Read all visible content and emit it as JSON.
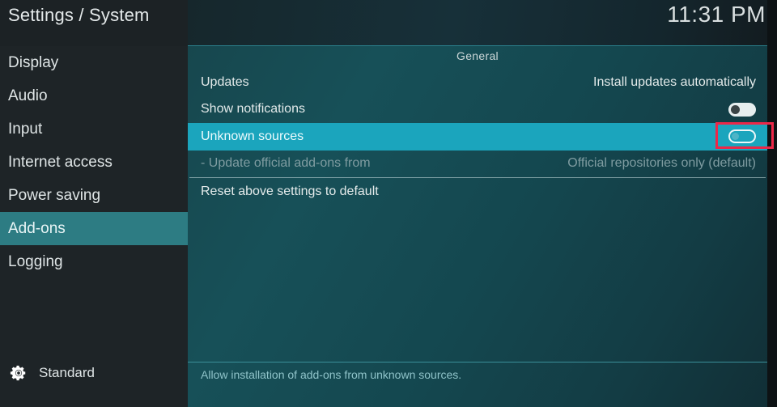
{
  "header": {
    "breadcrumb": "Settings / System",
    "clock": "11:31 PM"
  },
  "sidebar": {
    "items": [
      {
        "label": "Display",
        "active": false
      },
      {
        "label": "Audio",
        "active": false
      },
      {
        "label": "Input",
        "active": false
      },
      {
        "label": "Internet access",
        "active": false
      },
      {
        "label": "Power saving",
        "active": false
      },
      {
        "label": "Add-ons",
        "active": true
      },
      {
        "label": "Logging",
        "active": false
      }
    ],
    "profile": {
      "icon": "gear-icon",
      "label": "Standard"
    }
  },
  "main": {
    "section_title": "General",
    "rows": [
      {
        "label": "Updates",
        "value": "Install updates automatically",
        "control": "text",
        "state": "normal"
      },
      {
        "label": "Show notifications",
        "value": "",
        "control": "toggle",
        "toggle_on": false,
        "toggle_style": "filled",
        "state": "normal"
      },
      {
        "label": "Unknown sources",
        "value": "",
        "control": "toggle",
        "toggle_on": false,
        "toggle_style": "outline",
        "state": "selected"
      },
      {
        "label": "- Update official add-ons from",
        "value": "Official repositories only (default)",
        "control": "text",
        "state": "disabled"
      },
      {
        "label": "Reset above settings to default",
        "value": "",
        "control": "none",
        "state": "normal"
      }
    ]
  },
  "footer": {
    "help_text": "Allow installation of add-ons from unknown sources."
  },
  "annotation": {
    "shape": "rectangle",
    "color": "#ec2748",
    "targets": "unknown-sources-toggle"
  },
  "colors": {
    "sidebar_bg": "#1e2427",
    "sidebar_active": "#2d7c83",
    "row_selected": "#1ba5bd",
    "panel_teal": "#17474e",
    "accent_line": "#2e8f9c",
    "help_text": "#8fc3c9",
    "annotation_red": "#ec2748"
  }
}
